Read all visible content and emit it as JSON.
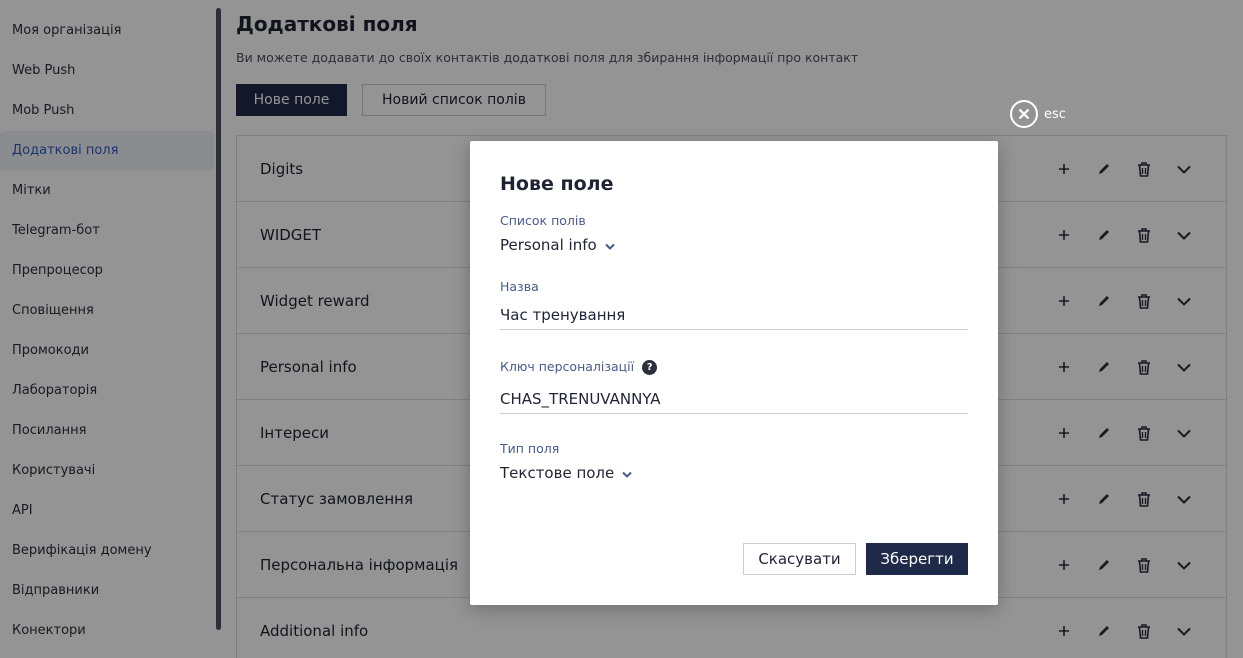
{
  "sidebar": {
    "items": [
      {
        "label": "Моя організація"
      },
      {
        "label": "Web Push"
      },
      {
        "label": "Mob Push"
      },
      {
        "label": "Додаткові поля"
      },
      {
        "label": "Мітки"
      },
      {
        "label": "Telegram-бот"
      },
      {
        "label": "Препроцесор"
      },
      {
        "label": "Сповіщення"
      },
      {
        "label": "Промокоди"
      },
      {
        "label": "Лабораторія"
      },
      {
        "label": "Посилання"
      },
      {
        "label": "Користувачі"
      },
      {
        "label": "API"
      },
      {
        "label": "Верифікація домену"
      },
      {
        "label": "Відправники"
      },
      {
        "label": "Конектори"
      }
    ],
    "active_index": 3
  },
  "main": {
    "title": "Додаткові поля",
    "description": "Ви можете додавати до своїх контактів додаткові поля для збирання інформації про контакт",
    "new_field_label": "Нове поле",
    "new_list_label": "Новий список полів",
    "field_lists": [
      {
        "name": "Digits"
      },
      {
        "name": "WIDGET"
      },
      {
        "name": "Widget reward"
      },
      {
        "name": "Personal info"
      },
      {
        "name": "Інтереси"
      },
      {
        "name": "Статус замовлення"
      },
      {
        "name": "Персональна інформація"
      },
      {
        "name": "Additional info"
      }
    ]
  },
  "esc_label": "esc",
  "modal": {
    "title": "Нове поле",
    "list_label": "Список полів",
    "list_value": "Personal info",
    "name_label": "Назва",
    "name_value": "Час тренування",
    "key_label": "Ключ персоналізації",
    "key_help": "?",
    "key_value": "CHAS_TRENUVANNYA",
    "type_label": "Тип поля",
    "type_value": "Текстове поле",
    "cancel_label": "Скасувати",
    "save_label": "Зберегти"
  },
  "icons": {
    "row_add": "plus-icon",
    "row_edit": "pencil-icon",
    "row_delete": "trash-icon",
    "row_expand": "chevron-down-icon",
    "close": "close-circle-icon",
    "help": "question-circle-icon"
  },
  "colors": {
    "primary": "#1f2a48",
    "active_link": "#2f5bb7",
    "label": "#4a5a86"
  }
}
